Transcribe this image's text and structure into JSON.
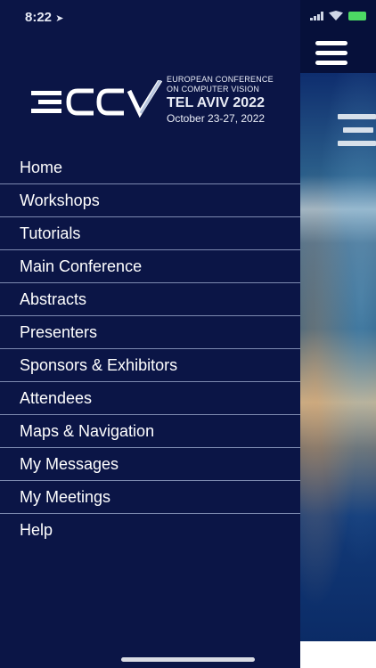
{
  "status_bar": {
    "time": "8:22"
  },
  "brand": {
    "mark_letters": "ECCV",
    "line1": "EUROPEAN CONFERENCE",
    "line2": "ON COMPUTER VISION",
    "line3": "TEL AVIV 2022",
    "line4": "October 23-27, 2022"
  },
  "menu": {
    "items": [
      {
        "label": "Home"
      },
      {
        "label": "Workshops"
      },
      {
        "label": "Tutorials"
      },
      {
        "label": "Main Conference"
      },
      {
        "label": "Abstracts"
      },
      {
        "label": "Presenters"
      },
      {
        "label": "Sponsors & Exhibitors"
      },
      {
        "label": "Attendees"
      },
      {
        "label": "Maps & Navigation"
      },
      {
        "label": "My Messages"
      },
      {
        "label": "My Meetings"
      },
      {
        "label": "Help"
      }
    ]
  },
  "icons": {
    "menu_toggle": "hamburger-icon",
    "signal": "cellular-signal-icon",
    "wifi": "wifi-icon",
    "battery": "battery-icon",
    "location": "location-arrow-icon"
  },
  "colors": {
    "drawer_bg": "#0b1546",
    "divider": "#7d8ab0",
    "text": "#ffffff",
    "battery": "#4cd964"
  }
}
